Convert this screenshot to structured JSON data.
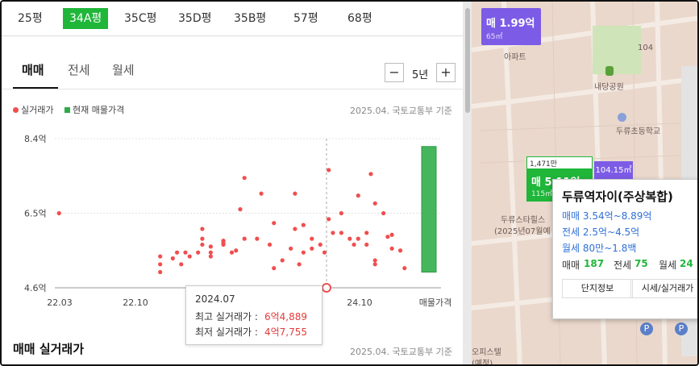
{
  "size_tabs": [
    "25평",
    "34A평",
    "35C평",
    "35D평",
    "35B평",
    "57평",
    "68평"
  ],
  "trade_tabs": [
    "매매",
    "전세",
    "월세"
  ],
  "period": {
    "minus": "−",
    "value": "5년",
    "plus": "+"
  },
  "legend": {
    "actual": "실거래가",
    "current": "현재 매물가격"
  },
  "source_note": "2025.04. 국토교통부 기준",
  "chart_data": {
    "type": "scatter",
    "y_ticks": [
      "8.4억",
      "6.5억",
      "4.6억"
    ],
    "x_ticks": [
      "22.03",
      "22.10",
      "24.10",
      "매물가격"
    ],
    "ylim": [
      4.6,
      8.4
    ],
    "xlim": [
      0,
      36
    ],
    "current_listing_range": [
      5.0,
      8.2
    ],
    "points": [
      [
        0.5,
        6.5
      ],
      [
        12.5,
        5.4
      ],
      [
        12.5,
        5.0
      ],
      [
        12.5,
        5.2
      ],
      [
        14,
        5.35
      ],
      [
        14.5,
        5.5
      ],
      [
        15,
        5.2
      ],
      [
        15.5,
        5.5
      ],
      [
        16,
        5.4
      ],
      [
        17,
        5.5
      ],
      [
        17.5,
        6.1
      ],
      [
        17.5,
        5.85
      ],
      [
        17.5,
        5.7
      ],
      [
        18.5,
        5.65
      ],
      [
        18.5,
        5.4
      ],
      [
        18.5,
        5.5
      ],
      [
        20,
        5.8
      ],
      [
        20,
        5.7
      ],
      [
        20,
        5.75
      ],
      [
        21,
        5.5
      ],
      [
        21.5,
        5.55
      ],
      [
        22,
        6.6
      ],
      [
        22.5,
        5.85
      ],
      [
        22.5,
        7.4
      ],
      [
        24,
        5.85
      ],
      [
        24.5,
        7.0
      ],
      [
        25.5,
        5.7
      ],
      [
        26,
        5.1
      ],
      [
        26,
        6.25
      ],
      [
        27,
        5.3
      ],
      [
        28,
        5.6
      ],
      [
        28.5,
        6.1
      ],
      [
        28.5,
        7.0
      ],
      [
        29,
        5.2
      ],
      [
        29.5,
        5.5
      ],
      [
        29.5,
        6.2
      ],
      [
        30.5,
        5.85
      ],
      [
        30.5,
        5.6
      ],
      [
        31.5,
        5.7
      ],
      [
        32,
        5.5
      ],
      [
        32.5,
        6.35
      ],
      [
        32.5,
        7.6
      ],
      [
        33,
        6.0
      ],
      [
        34,
        6.5
      ],
      [
        34,
        6.0
      ],
      [
        35,
        5.85
      ],
      [
        35.5,
        5.7
      ],
      [
        36,
        5.85
      ],
      [
        36,
        6.95
      ],
      [
        37,
        5.7
      ],
      [
        37,
        6.0
      ],
      [
        37.5,
        7.5
      ],
      [
        38,
        6.75
      ],
      [
        38,
        5.3
      ],
      [
        38,
        5.2
      ],
      [
        39,
        6.5
      ],
      [
        39.5,
        5.9
      ],
      [
        40,
        5.95
      ],
      [
        40,
        5.6
      ],
      [
        41,
        5.55
      ],
      [
        41.5,
        5.1
      ]
    ],
    "highlight_point": [
      26,
      4.6
    ]
  },
  "tooltip": {
    "date": "2024.07",
    "max_label": "최고 실거래가 :",
    "max_value": "6억4,889",
    "min_label": "최저 실거래가 :",
    "min_value": "4억7,755"
  },
  "section_title": "매매 실거래가",
  "map": {
    "pin_top": {
      "title": "매 1.99억",
      "sub": "65㎡"
    },
    "pin_main": {
      "badge": "1,471만",
      "title": "매 5.11억",
      "sub": "115㎡"
    },
    "pin_side": "104.15㎡",
    "labels": [
      "아파트",
      "104",
      "내당공원",
      "두류초등학교",
      "두류스타힐스",
      "(2025년07월예",
      "104",
      "오피스텔",
      "(예정)"
    ],
    "card": {
      "title": "두류역자이(주상복합)",
      "sale": "매매 3.54억~8.89억",
      "jeonse": "전세 2.5억~4.5억",
      "wolse": "월세 80만~1.8백",
      "counts": {
        "sale_label": "매매",
        "sale": "187",
        "jeonse_label": "전세",
        "jeonse": "75",
        "wolse_label": "월세",
        "wolse": "24"
      },
      "btn1": "단지정보",
      "btn2": "시세/실거래가"
    }
  },
  "colors": {
    "green": "#1fb63a",
    "red": "#f04e4e",
    "purple": "#7c5ce6"
  }
}
